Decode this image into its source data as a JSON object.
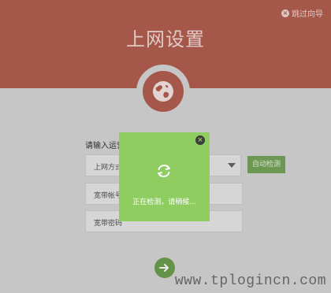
{
  "header": {
    "title": "上网设置",
    "skip_label": "跳过向导"
  },
  "form": {
    "isp_prompt": "请输入运营",
    "connection_type_label": "上网方式",
    "auto_detect_label": "自动检测",
    "account_label": "宽带帐号",
    "password_label": "宽带密码"
  },
  "modal": {
    "message": "正在检测，请稍候..."
  },
  "watermark": "www.tplogincn.com",
  "icons": {
    "skip": "close-circle-icon",
    "globe": "globe-icon",
    "refresh": "refresh-icon",
    "close": "close-icon",
    "next": "arrow-right-icon"
  },
  "colors": {
    "header": "#b45f50",
    "modal": "#8fcd61",
    "accent_green": "#76a55b"
  }
}
